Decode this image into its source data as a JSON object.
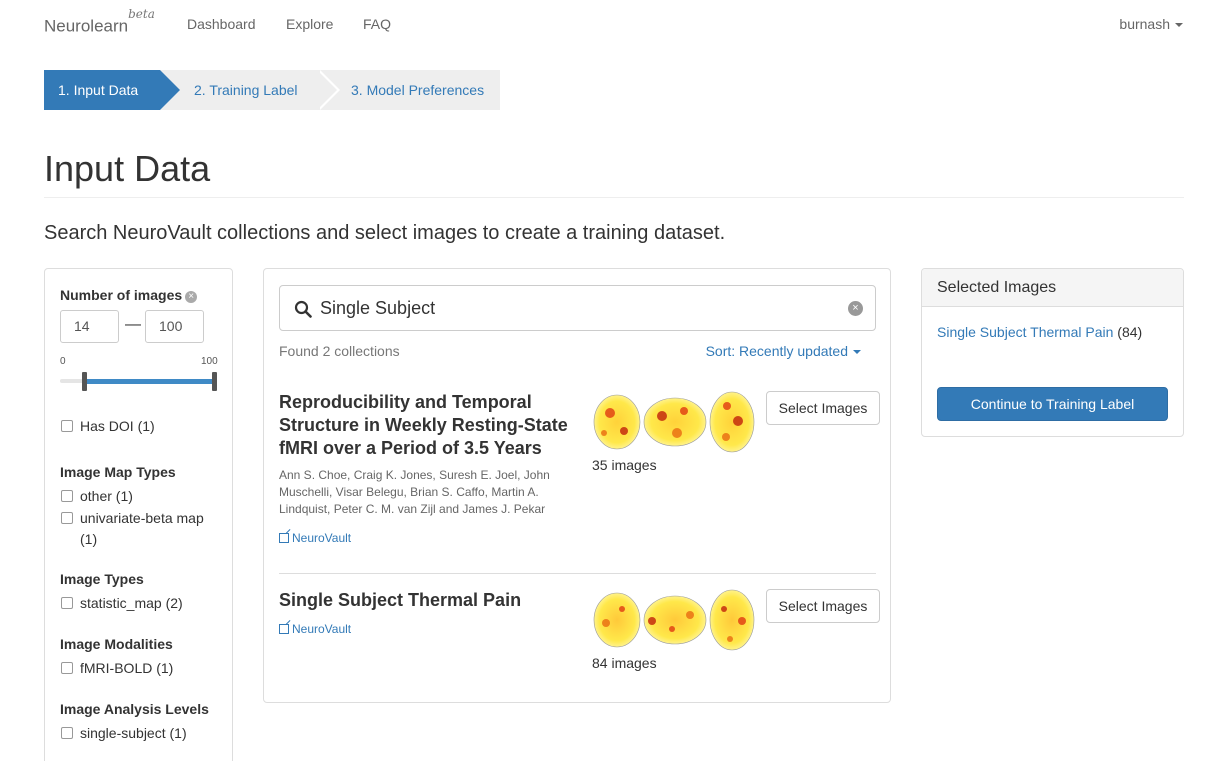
{
  "navbar": {
    "brand": "Neurolearn",
    "brand_badge": "beta",
    "links": [
      "Dashboard",
      "Explore",
      "FAQ"
    ],
    "user": "burnash"
  },
  "steps": [
    "1. Input Data",
    "2. Training Label",
    "3. Model Preferences"
  ],
  "page": {
    "title": "Input Data",
    "lead": "Search NeuroVault collections and select images to create a training dataset."
  },
  "filters": {
    "number_of_images": {
      "heading": "Number of images",
      "min_value": "14",
      "max_value": "100",
      "range_min_label": "0",
      "range_max_label": "100",
      "range_low": 14,
      "range_high": 100
    },
    "has_doi": "Has DOI (1)",
    "image_map_types": {
      "heading": "Image Map Types",
      "options": [
        "other (1)",
        "univariate-beta map",
        "(1)"
      ]
    },
    "image_types": {
      "heading": "Image Types",
      "options": [
        "statistic_map (2)"
      ]
    },
    "image_modalities": {
      "heading": "Image Modalities",
      "options": [
        "fMRI-BOLD (1)"
      ]
    },
    "image_analysis_levels": {
      "heading": "Image Analysis Levels",
      "options": [
        "single-subject (1)"
      ]
    }
  },
  "search": {
    "value": "Single Subject",
    "found": "Found 2 collections",
    "sort_label": "Sort: Recently updated"
  },
  "collections": [
    {
      "title_lines": [
        "Reproducibility and Temporal",
        "Structure in Weekly Resting-State",
        "fMRI over a Period of 3.5 Years"
      ],
      "authors_lines": [
        "Ann S. Choe, Craig K. Jones, Suresh E. Joel, John",
        "Muschelli, Visar Belegu, Brian S. Caffo, Martin A.",
        "Lindquist, Peter C. M. van Zijl and James J. Pekar"
      ],
      "link": "NeuroVault",
      "image_count": "35 images",
      "button": "Select Images"
    },
    {
      "title_lines": [
        "Single Subject Thermal Pain"
      ],
      "link": "NeuroVault",
      "image_count": "84 images",
      "button": "Select Images"
    }
  ],
  "selected": {
    "heading": "Selected Images",
    "item_name": "Single Subject Thermal Pain",
    "item_count": "(84)",
    "continue_button": "Continue to Training Label"
  },
  "colors": {
    "primary": "#337ab7",
    "slider": "#3f8ac6",
    "brain_glow": "#ffe84a",
    "brain_hot": "#e03a10"
  }
}
